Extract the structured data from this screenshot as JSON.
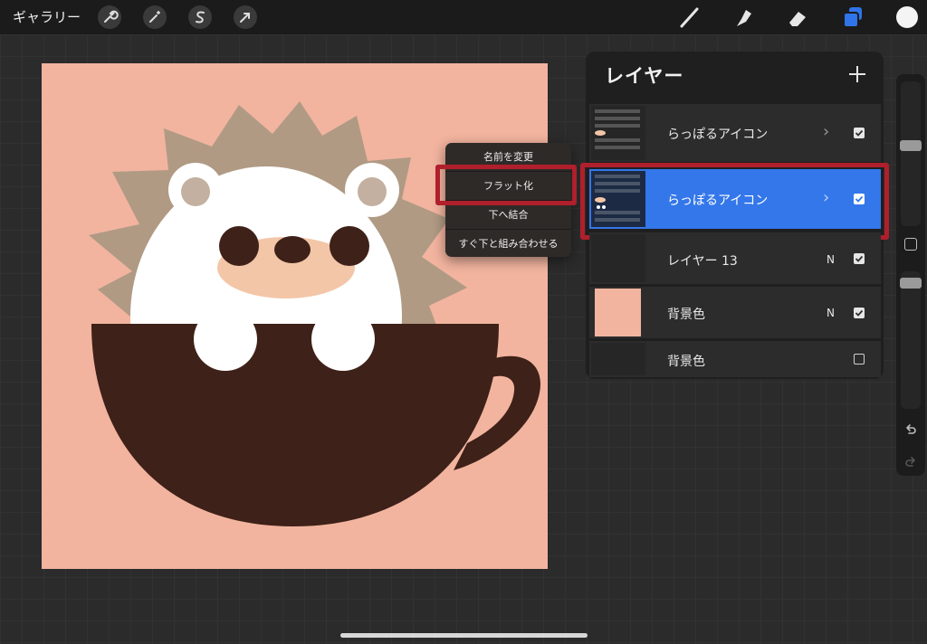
{
  "topbar": {
    "gallery_label": "ギャラリー",
    "left_tools": [
      "wrench-icon",
      "magic-wand-icon",
      "selection-s-icon",
      "arrow-transform-icon"
    ],
    "right_tools": [
      "brush-icon",
      "smudge-icon",
      "eraser-icon",
      "layers-icon"
    ],
    "current_color": "#f4f4f4"
  },
  "context_menu": {
    "items": [
      "名前を変更",
      "フラット化",
      "下へ結合",
      "すぐ下と組み合わせる"
    ]
  },
  "layers_panel": {
    "title": "レイヤー",
    "rows": [
      {
        "name": "らっぽるアイコン",
        "indicator": "›",
        "checked": true,
        "selected": false
      },
      {
        "name": "らっぽるアイコン",
        "indicator": "›",
        "checked": true,
        "selected": true
      },
      {
        "name": "レイヤー 13",
        "indicator": "N",
        "checked": true,
        "selected": false
      },
      {
        "name": "背景色",
        "indicator": "N",
        "checked": true,
        "selected": false
      },
      {
        "name": "背景色",
        "indicator": "",
        "checked": false,
        "selected": false
      }
    ]
  },
  "colors": {
    "accent": "#3477ea",
    "highlight": "#b01f2c",
    "canvas_bg": "#f2b49f",
    "cup": "#3e2118",
    "quills": "#b09a84"
  }
}
